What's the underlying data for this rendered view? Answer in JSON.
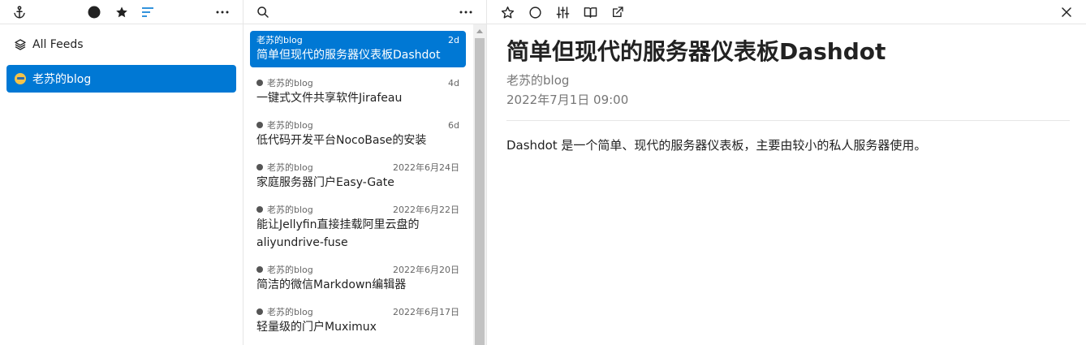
{
  "nav": {
    "toolbar_icons": [
      "anchor-icon",
      "circle-icon",
      "star-icon",
      "list-icon",
      "more-icon"
    ],
    "items": [
      {
        "label": "All Feeds",
        "icon": "layers-icon"
      },
      {
        "label": "老苏的blog",
        "icon": "favicon-icon"
      }
    ]
  },
  "list": {
    "toolbar_icons": [
      "search-icon",
      "more-icon"
    ],
    "articles": [
      {
        "source": "老苏的blog",
        "date": "2d",
        "title": "简单但现代的服务器仪表板Dashdot"
      },
      {
        "source": "老苏的blog",
        "date": "4d",
        "title": "一键式文件共享软件Jirafeau"
      },
      {
        "source": "老苏的blog",
        "date": "6d",
        "title": "低代码开发平台NocoBase的安装"
      },
      {
        "source": "老苏的blog",
        "date": "2022年6月24日",
        "title": "家庭服务器门户Easy-Gate"
      },
      {
        "source": "老苏的blog",
        "date": "2022年6月22日",
        "title": "能让Jellyfin直接挂载阿里云盘的aliyundrive-fuse"
      },
      {
        "source": "老苏的blog",
        "date": "2022年6月20日",
        "title": "简洁的微信Markdown编辑器"
      },
      {
        "source": "老苏的blog",
        "date": "2022年6月17日",
        "title": "轻量级的门户Muximux"
      }
    ]
  },
  "article": {
    "toolbar_icons": [
      "star-outline-icon",
      "circle-outline-icon",
      "sliders-icon",
      "book-icon",
      "open-external-icon",
      "close-icon"
    ],
    "title": "简单但现代的服务器仪表板Dashdot",
    "source": "老苏的blog",
    "date": "2022年7月1日 09:00",
    "content": "Dashdot 是一个简单、现代的服务器仪表板，主要由较小的私人服务器使用。"
  },
  "colors": {
    "accent": "#0078d4",
    "border": "#e6e6e6",
    "muted": "#777777"
  }
}
